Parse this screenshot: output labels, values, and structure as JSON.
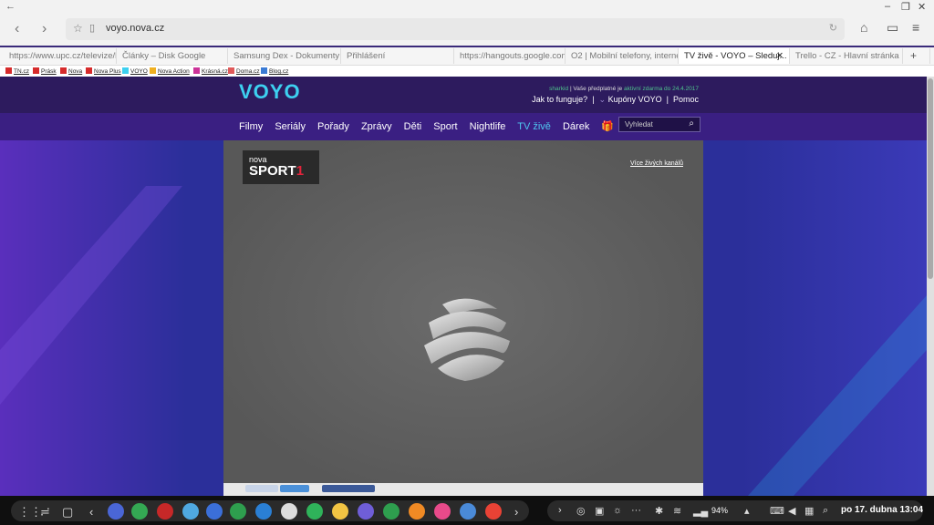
{
  "browser": {
    "url": "voyo.nova.cz",
    "tabs": [
      {
        "label": "https://www.upc.cz/televize/h..."
      },
      {
        "label": "Články – Disk Google"
      },
      {
        "label": "Samsung Dex - Dokumenty G..."
      },
      {
        "label": "Přihlášení"
      },
      {
        "label": "https://hangouts.google.com..."
      },
      {
        "label": "O2 | Mobilní telefony, internet,..."
      },
      {
        "label": "TV živě - VOYO – Sleduj...",
        "active": true
      },
      {
        "label": "Trello - CZ - Hlavní stránka"
      }
    ],
    "new_tab": "+",
    "bookmarks": [
      {
        "label": "TN.cz",
        "color": "#d62b2b"
      },
      {
        "label": "Prásk",
        "color": "#d62b2b"
      },
      {
        "label": "Nova",
        "color": "#d62b2b"
      },
      {
        "label": "Nova Plus",
        "color": "#d62b2b"
      },
      {
        "label": "VOYO",
        "color": "#3dd0f0"
      },
      {
        "label": "Nova Action",
        "color": "#f0b020"
      },
      {
        "label": "Krásná.cz",
        "color": "#cc3399"
      },
      {
        "label": "Doma.cz",
        "color": "#e05a5a"
      },
      {
        "label": "Blog.cz",
        "color": "#3a7bd5"
      }
    ]
  },
  "site": {
    "logo": "VOYO",
    "promo_1": "sharkid",
    "promo_2": "| Vaše předplatné je",
    "promo_3": "aktivní zdarma do 24.4.2017",
    "header_links": [
      "Jak to funguje?",
      "Kupóny VOYO",
      "Pomoc"
    ],
    "nav": [
      "Filmy",
      "Seriály",
      "Pořady",
      "Zprávy",
      "Děti",
      "Sport",
      "Nightlife",
      "TV živě",
      "Dárek"
    ],
    "active_nav": "TV živě",
    "search_placeholder": "Vyhledat",
    "channel_small": "nova",
    "channel_big": "SPORT",
    "channel_num": "1",
    "more_channels": "Více živých kanálů"
  },
  "taskbar": {
    "battery": "94%",
    "clock": "po 17. dubna 13:04"
  }
}
